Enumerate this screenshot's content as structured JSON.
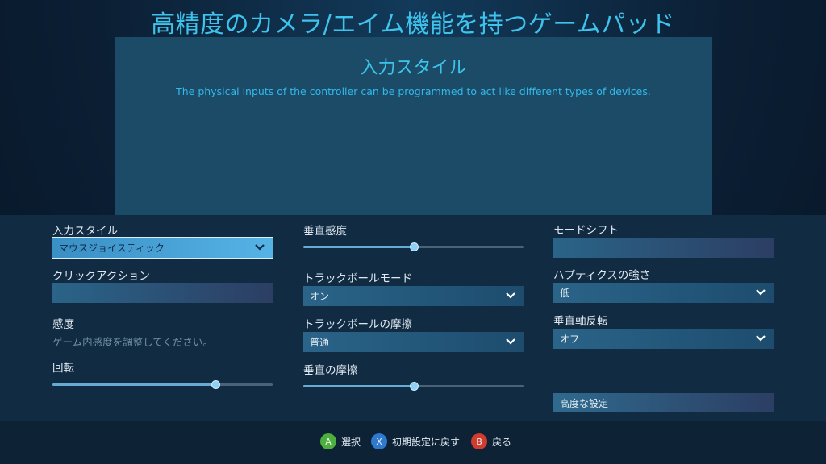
{
  "header": {
    "title": "高精度のカメラ/エイム機能を持つゲームパッド"
  },
  "info_panel": {
    "title": "入力スタイル",
    "description": "The physical inputs of the controller can be programmed to act like different types of devices."
  },
  "column_left": {
    "input_style": {
      "label": "入力スタイル",
      "value": "マウスジョイスティック"
    },
    "click_action": {
      "label": "クリックアクション",
      "value": ""
    },
    "sensitivity": {
      "label": "感度",
      "hint": "ゲーム内感度を調整してください。"
    },
    "rotation": {
      "label": "回転",
      "level": 0.74
    }
  },
  "column_middle": {
    "vertical_sensitivity": {
      "label": "垂直感度",
      "level": 0.5
    },
    "trackball_mode": {
      "label": "トラックボールモード",
      "value": "オン"
    },
    "trackball_friction": {
      "label": "トラックボールの摩擦",
      "value": "普通"
    },
    "vertical_friction": {
      "label": "垂直の摩擦",
      "level": 0.5
    }
  },
  "column_right": {
    "mode_shift": {
      "label": "モードシフト",
      "value": ""
    },
    "haptics_strength": {
      "label": "ハプティクスの強さ",
      "value": "低"
    },
    "invert_vertical": {
      "label": "垂直軸反転",
      "value": "オフ"
    },
    "advanced_settings": {
      "label": "高度な設定"
    }
  },
  "footer": {
    "hints": [
      {
        "button": "A",
        "label": "選択",
        "color": "#4caf3e"
      },
      {
        "button": "X",
        "label": "初期設定に戻す",
        "color": "#2f7ad0"
      },
      {
        "button": "B",
        "label": "戻る",
        "color": "#d03c2f"
      }
    ]
  },
  "colors": {
    "accent": "#3ec3ec",
    "panel": "#1b4b66",
    "slider_fill": "#66aad6"
  }
}
